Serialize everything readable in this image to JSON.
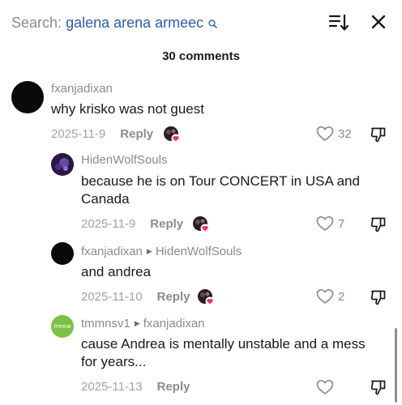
{
  "search": {
    "label": "Search:",
    "query": "galena arena armeec"
  },
  "icons": {
    "search": "search-icon",
    "sort": "sort-icon",
    "close": "close-icon",
    "like": "heart-outline-icon",
    "dislike": "thumbs-down-icon",
    "creator_liked": "creator-liked-avatar"
  },
  "comments_count": "30 comments",
  "comments": [
    {
      "username": "fxanjadixan",
      "text": "why krisko was not guest",
      "date": "2025-11-9",
      "reply_label": "Reply",
      "creator_liked": true,
      "likes": "32",
      "avatar_color": "#0a0a0a"
    },
    {
      "username": "HidenWolfSouls",
      "text_line1": "because he is on Tour CONCERT in USA and",
      "text_line2": "Canada",
      "date": "2025-11-9",
      "reply_label": "Reply",
      "creator_liked": true,
      "likes": "7",
      "avatar_color": "#3a1f5c"
    },
    {
      "username": "fxanjadixan",
      "reply_to": "HidenWolfSouls",
      "text": "and andrea",
      "date": "2025-11-10",
      "reply_label": "Reply",
      "creator_liked": true,
      "likes": "2",
      "avatar_color": "#0a0a0a"
    },
    {
      "username": "tmmnsv1",
      "reply_to": "fxanjadixan",
      "avatar_text": "meow",
      "text_line1": "cause Andrea is mentally unstable and a mess",
      "text_line2": "for years...",
      "date": "2025-11-13",
      "reply_label": "Reply",
      "creator_liked": false,
      "likes": "",
      "avatar_color": "#7cc242"
    }
  ]
}
